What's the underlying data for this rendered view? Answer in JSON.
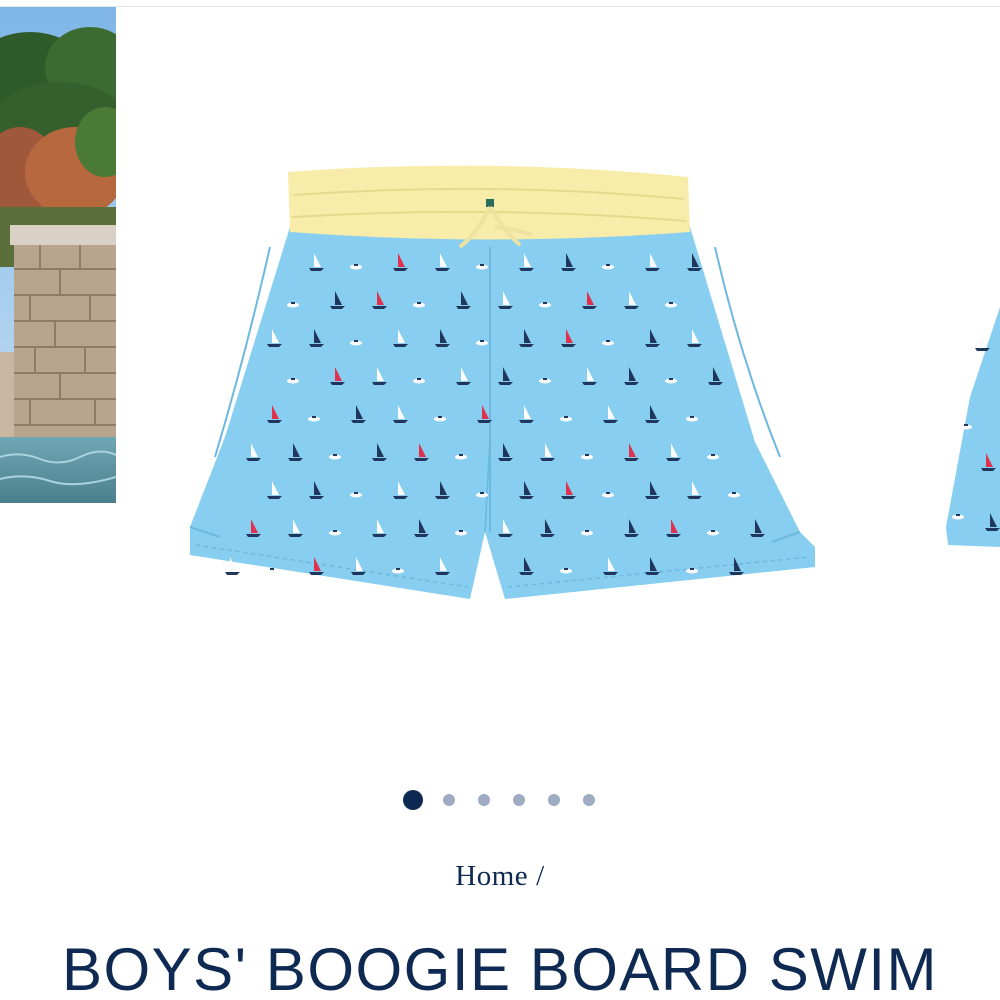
{
  "colors": {
    "navy": "#0f2a52",
    "dot_inactive": "#9eabc1",
    "shorts_blue": "#87cef0",
    "waistband_yellow": "#f7ecaa",
    "sail_red": "#e0324d",
    "sail_navy": "#21365c",
    "sail_white": "#fbfbfb"
  },
  "gallery": {
    "slides": [
      {
        "name": "lifestyle-poolside-photo",
        "icon": "photo"
      },
      {
        "name": "product-shorts-front",
        "icon": "photo"
      },
      {
        "name": "product-shorts-side",
        "icon": "photo"
      }
    ],
    "active_index": 0,
    "slide_count": 6
  },
  "breadcrumb": {
    "home_label": "Home",
    "separator": "/"
  },
  "product": {
    "title": "BOYS' BOOGIE BOARD SWIM"
  }
}
